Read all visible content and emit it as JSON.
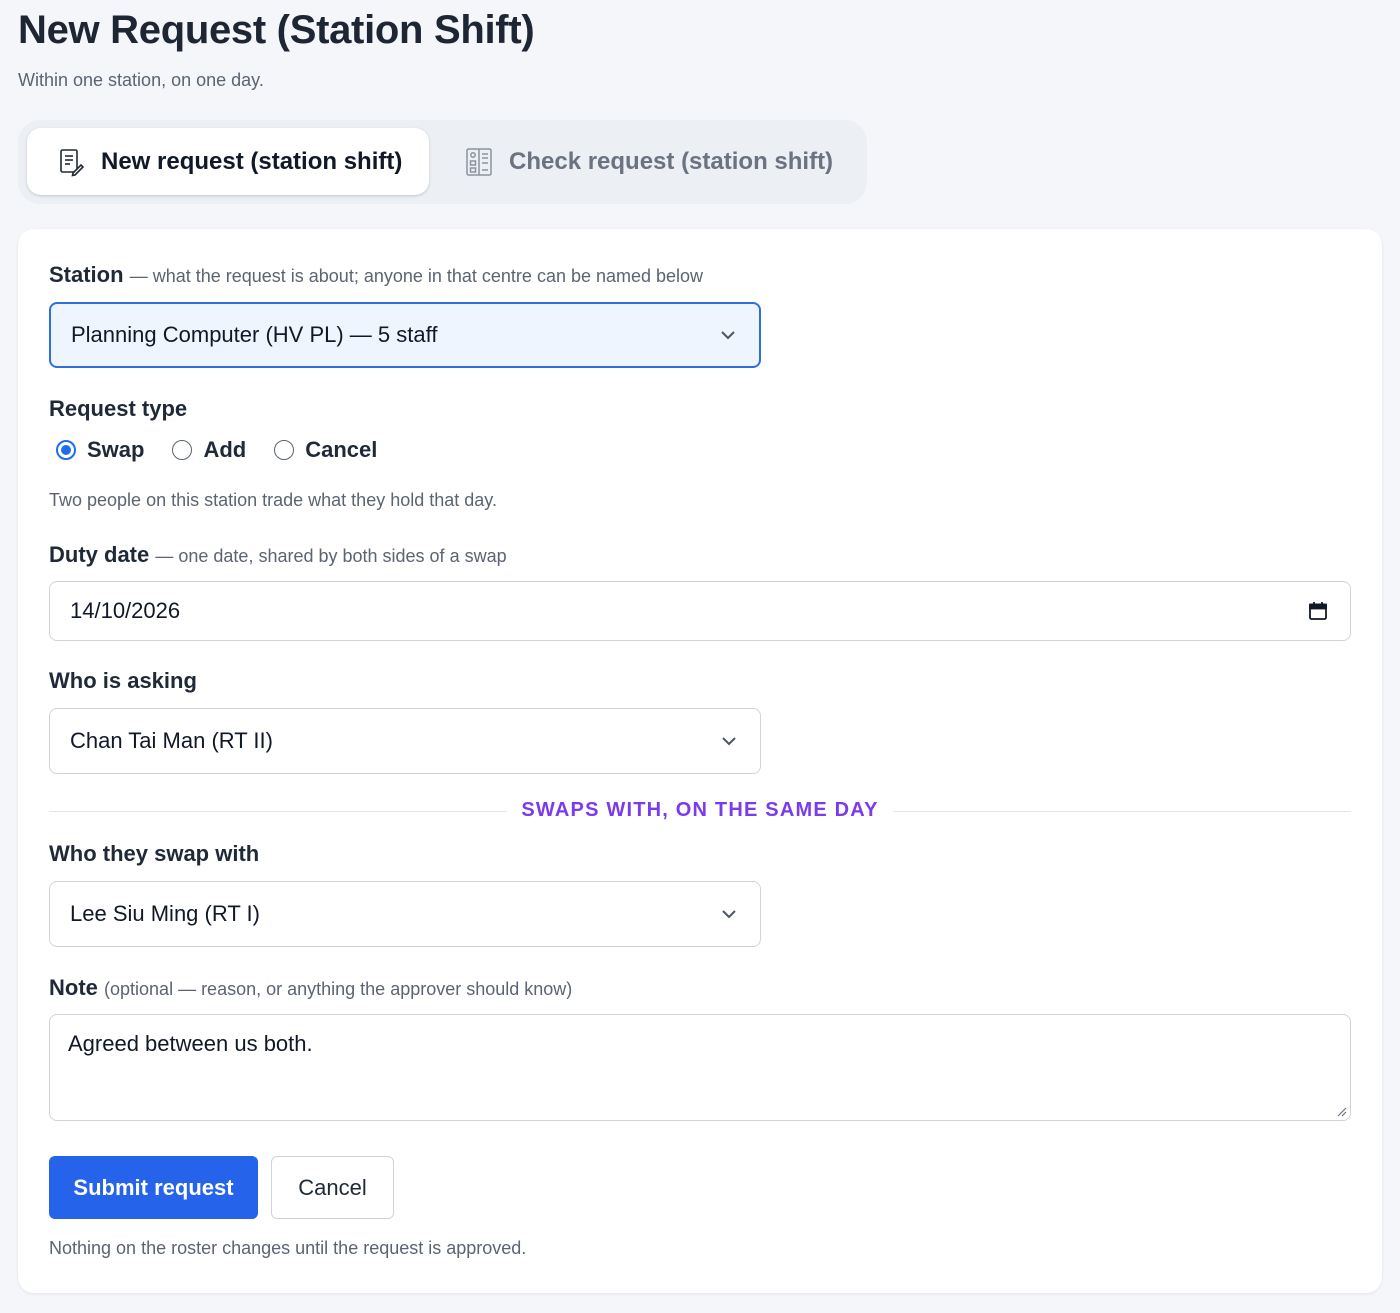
{
  "page": {
    "title": "New Request (Station Shift)",
    "subtitle": "Within one station, on one day."
  },
  "tabs": [
    {
      "label": "New request (station shift)",
      "icon": "document-pen-icon",
      "active": true
    },
    {
      "label": "Check request (station shift)",
      "icon": "checklist-icon",
      "active": false
    }
  ],
  "form": {
    "station": {
      "label": "Station",
      "hint": "— what the request is about; anyone in that centre can be named below",
      "value": "Planning Computer (HV PL) — 5 staff"
    },
    "request_type": {
      "label": "Request type",
      "options": [
        "Swap",
        "Add",
        "Cancel"
      ],
      "selected": "Swap",
      "help": "Two people on this station trade what they hold that day."
    },
    "duty_date": {
      "label": "Duty date",
      "hint": "— one date, shared by both sides of a swap",
      "value": "14/10/2026"
    },
    "who_asking": {
      "label": "Who is asking",
      "value": "Chan Tai Man (RT II)"
    },
    "divider_text": "SWAPS WITH, ON THE SAME DAY",
    "swap_with": {
      "label": "Who they swap with",
      "value": "Lee Siu Ming (RT I)"
    },
    "note": {
      "label": "Note",
      "hint": "(optional — reason, or anything the approver should know)",
      "value": "Agreed between us both."
    },
    "submit_label": "Submit request",
    "cancel_label": "Cancel",
    "footer_note": "Nothing on the roster changes until the request is approved."
  },
  "colors": {
    "primary": "#2563eb",
    "accent_purple": "#7c3aed",
    "focus_bg": "#eef5ff",
    "radio_checked": "#1f6ee6"
  }
}
